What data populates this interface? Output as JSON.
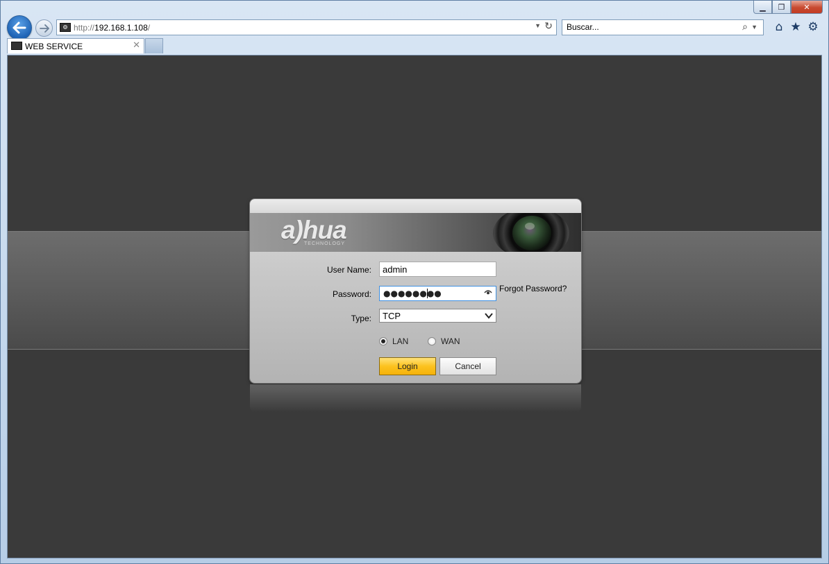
{
  "browser": {
    "address": {
      "scheme": "http://",
      "host": "192.168.1.108",
      "path": "/"
    },
    "search_placeholder": "Buscar...",
    "tab_title": "WEB SERVICE",
    "window_controls": [
      "minimize-icon",
      "restore-icon",
      "close-icon"
    ],
    "toolbar_icons": [
      "home-icon",
      "favorites-star-icon",
      "settings-gear-icon"
    ]
  },
  "login": {
    "brand": "a)hua",
    "brand_sub": "TECHNOLOGY",
    "username_label": "User Name:",
    "username_value": "admin",
    "password_label": "Password:",
    "password_mask": "●●●●●●●●",
    "forgot_label": "Forgot Password?",
    "type_label": "Type:",
    "type_value": "TCP",
    "network_options": [
      {
        "label": "LAN",
        "checked": true
      },
      {
        "label": "WAN",
        "checked": false
      }
    ],
    "login_button": "Login",
    "cancel_button": "Cancel"
  },
  "colors": {
    "page_bg": "#3a3a3a",
    "login_accent": "#fcc21f",
    "browser_accent": "#1e63b5"
  }
}
